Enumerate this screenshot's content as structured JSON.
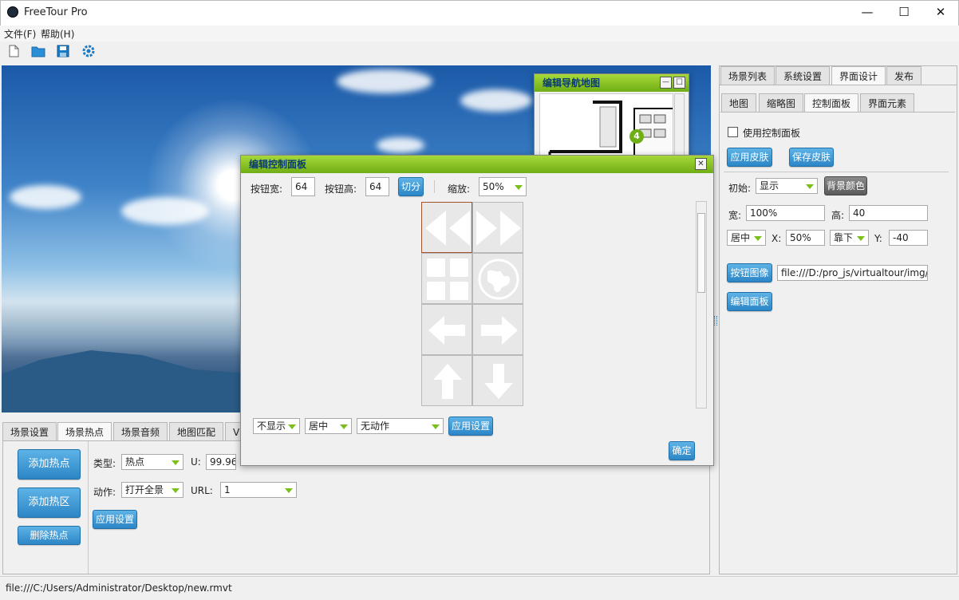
{
  "app": {
    "title": "FreeTour Pro",
    "minimize": "—",
    "maximize": "☐",
    "close": "✕"
  },
  "menu": {
    "file": "文件(F)",
    "help": "帮助(H)"
  },
  "toolbar": {
    "icons": [
      "new-file-icon",
      "open-folder-icon",
      "save-icon",
      "settings-icon"
    ]
  },
  "bottom_tabs": [
    "场景设置",
    "场景热点",
    "场景音频",
    "地图匹配",
    "VR"
  ],
  "hotspot": {
    "add_hotspot": "添加热点",
    "add_area": "添加热区",
    "delete_hotspot": "删除热点",
    "type_label": "类型:",
    "type_value": "热点",
    "u_label": "U:",
    "u_value": "99.96",
    "action_label": "动作:",
    "action_value": "打开全景",
    "url_label": "URL:",
    "url_value": "1",
    "apply": "应用设置"
  },
  "right_tabs": [
    "场景列表",
    "系统设置",
    "界面设计",
    "发布"
  ],
  "right_subtabs": [
    "地图",
    "缩略图",
    "控制面板",
    "界面元素"
  ],
  "control_panel": {
    "use_panel": "使用控制面板",
    "apply_skin": "应用皮肤",
    "save_skin": "保存皮肤",
    "initial_label": "初始:",
    "initial_value": "显示",
    "bg_color": "背景颜色",
    "width_label": "宽:",
    "width_value": "100%",
    "height_label": "高:",
    "height_value": "40",
    "halign_value": "居中",
    "x_label": "X:",
    "x_value": "50%",
    "valign_value": "靠下",
    "y_label": "Y:",
    "y_value": "-40",
    "button_image": "按钮图像",
    "button_image_path": "file:///D:/pro_js/virtualtour/img/skir",
    "edit_panel": "编辑面板"
  },
  "nav_map_dialog": {
    "title": "编辑导航地图",
    "badge": "4"
  },
  "panel_dialog": {
    "title": "编辑控制面板",
    "btn_width_label": "按钮宽:",
    "btn_width_value": "64",
    "btn_height_label": "按钮高:",
    "btn_height_value": "64",
    "split": "切分",
    "zoom_label": "缩放:",
    "zoom_value": "50%",
    "visibility_value": "不显示",
    "align_value": "居中",
    "action_value": "无动作",
    "apply": "应用设置",
    "ok": "确定",
    "grid_icons": [
      "rewind-icon",
      "forward-icon",
      "thumbnails-icon",
      "globe-icon",
      "arrow-left-icon",
      "arrow-right-icon",
      "arrow-up-icon",
      "arrow-down-icon"
    ]
  },
  "status": {
    "path": "file:///C:/Users/Administrator/Desktop/new.rmvt"
  },
  "colors": {
    "accent_blue": "#2c86c6",
    "accent_green": "#7bbf1b"
  }
}
